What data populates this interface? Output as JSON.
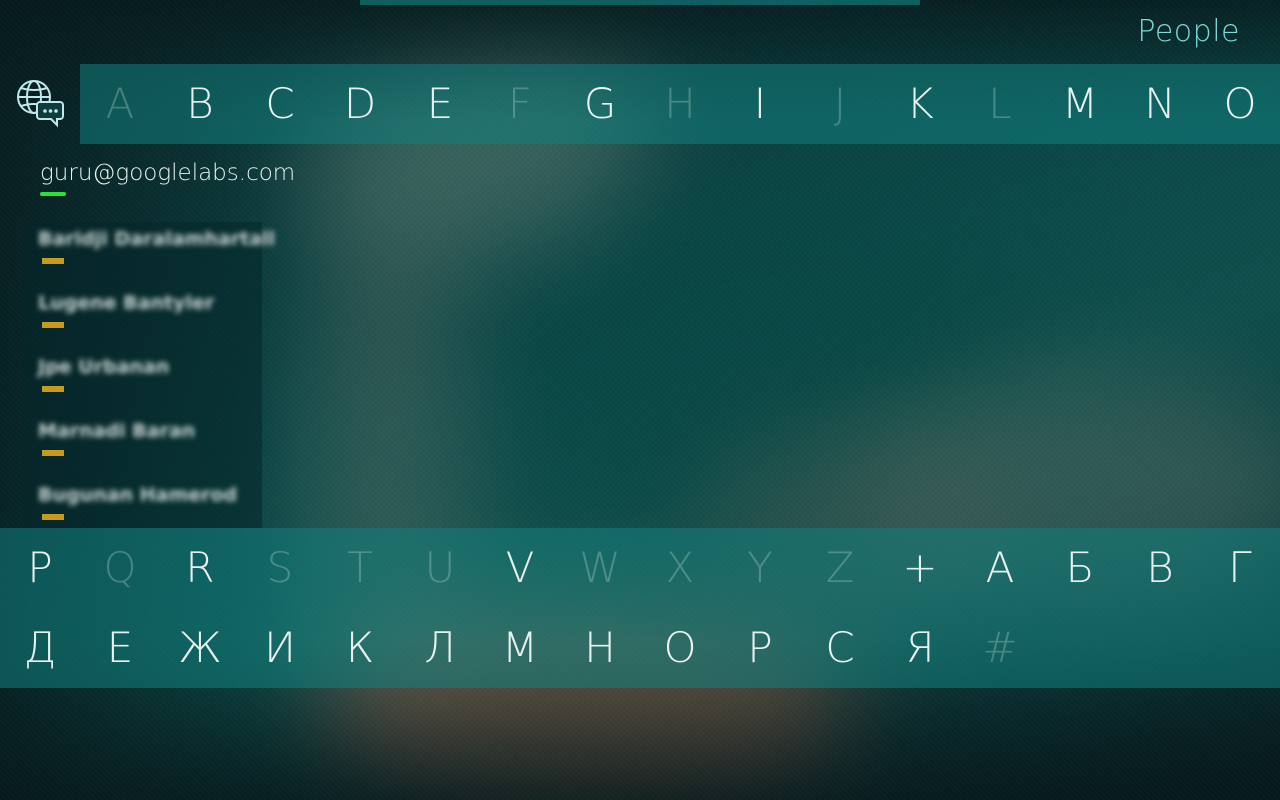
{
  "header": {
    "title": "People"
  },
  "account": {
    "email": "guru@googlelabs.com",
    "status_color": "#28e23a"
  },
  "contacts": [
    {
      "name": "Baridji Daralamhartall"
    },
    {
      "name": "Lugene Bantyler"
    },
    {
      "name": "Jpe Urbanan"
    },
    {
      "name": "Marnadi Baran"
    },
    {
      "name": "Bugunan Hamerod"
    }
  ],
  "contact_indicator_color": "#c99a1a",
  "index_rows": [
    [
      {
        "c": "A",
        "active": false
      },
      {
        "c": "B",
        "active": true
      },
      {
        "c": "C",
        "active": true
      },
      {
        "c": "D",
        "active": true
      },
      {
        "c": "E",
        "active": true
      },
      {
        "c": "F",
        "active": false
      },
      {
        "c": "G",
        "active": true
      },
      {
        "c": "H",
        "active": false
      },
      {
        "c": "I",
        "active": true
      },
      {
        "c": "J",
        "active": false
      },
      {
        "c": "K",
        "active": true
      },
      {
        "c": "L",
        "active": false
      },
      {
        "c": "M",
        "active": true
      },
      {
        "c": "N",
        "active": true
      },
      {
        "c": "O",
        "active": true
      }
    ],
    [
      {
        "c": "P",
        "active": true
      },
      {
        "c": "Q",
        "active": false
      },
      {
        "c": "R",
        "active": true
      },
      {
        "c": "S",
        "active": false
      },
      {
        "c": "T",
        "active": false
      },
      {
        "c": "U",
        "active": false
      },
      {
        "c": "V",
        "active": true
      },
      {
        "c": "W",
        "active": false
      },
      {
        "c": "X",
        "active": false
      },
      {
        "c": "Y",
        "active": false
      },
      {
        "c": "Z",
        "active": false
      },
      {
        "c": "+",
        "active": true
      },
      {
        "c": "А",
        "active": true
      },
      {
        "c": "Б",
        "active": true
      },
      {
        "c": "В",
        "active": true
      },
      {
        "c": "Г",
        "active": true
      }
    ],
    [
      {
        "c": "Д",
        "active": true
      },
      {
        "c": "Е",
        "active": true
      },
      {
        "c": "Ж",
        "active": true
      },
      {
        "c": "И",
        "active": true
      },
      {
        "c": "К",
        "active": true
      },
      {
        "c": "Л",
        "active": true
      },
      {
        "c": "М",
        "active": true
      },
      {
        "c": "Н",
        "active": true
      },
      {
        "c": "О",
        "active": true
      },
      {
        "c": "Р",
        "active": true
      },
      {
        "c": "С",
        "active": true
      },
      {
        "c": "Я",
        "active": true
      },
      {
        "c": "#",
        "active": false
      }
    ]
  ],
  "icons": {
    "index_toggle": "globe-chat-icon"
  },
  "colors": {
    "accent": "#7fd6d6",
    "band": "#12807e"
  }
}
